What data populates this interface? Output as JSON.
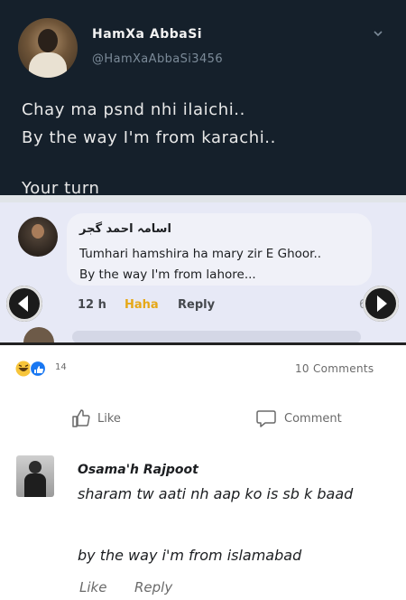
{
  "tweet": {
    "name": "HamXa AbbaSi",
    "handle": "@HamXaAbbaSi3456",
    "text": "Chay ma psnd nhi ilaichi..\nBy the way I'm from karachi..",
    "footer": "Your turn"
  },
  "inner_comment": {
    "author": "اسامہ احمد گجر",
    "text": "Tumhari hamshira ha mary zir E Ghoor..\nBy the way I'm from lahore...",
    "time": "12 h",
    "reaction": "Haha",
    "reply": "Reply",
    "reaction_count_partial": "6"
  },
  "post": {
    "reaction_count": "14",
    "comments_count": "10 Comments",
    "like_label": "Like",
    "comment_label": "Comment"
  },
  "comment": {
    "author": "Osama'h Rajpoot",
    "text": "sharam tw aati nh aap ko is sb k baad",
    "text2": "by the way i'm from islamabad",
    "like": "Like",
    "reply": "Reply"
  },
  "colors": {
    "tweet_bg": "#15202b",
    "inner_bg": "#e7e9f6",
    "haha": "#e6a817",
    "like_blue": "#1877f2"
  },
  "icons": [
    "chevron-down-icon",
    "arrow-left-icon",
    "arrow-right-icon",
    "haha-emoji-icon",
    "like-reaction-icon",
    "thumbs-up-icon",
    "comment-icon"
  ]
}
